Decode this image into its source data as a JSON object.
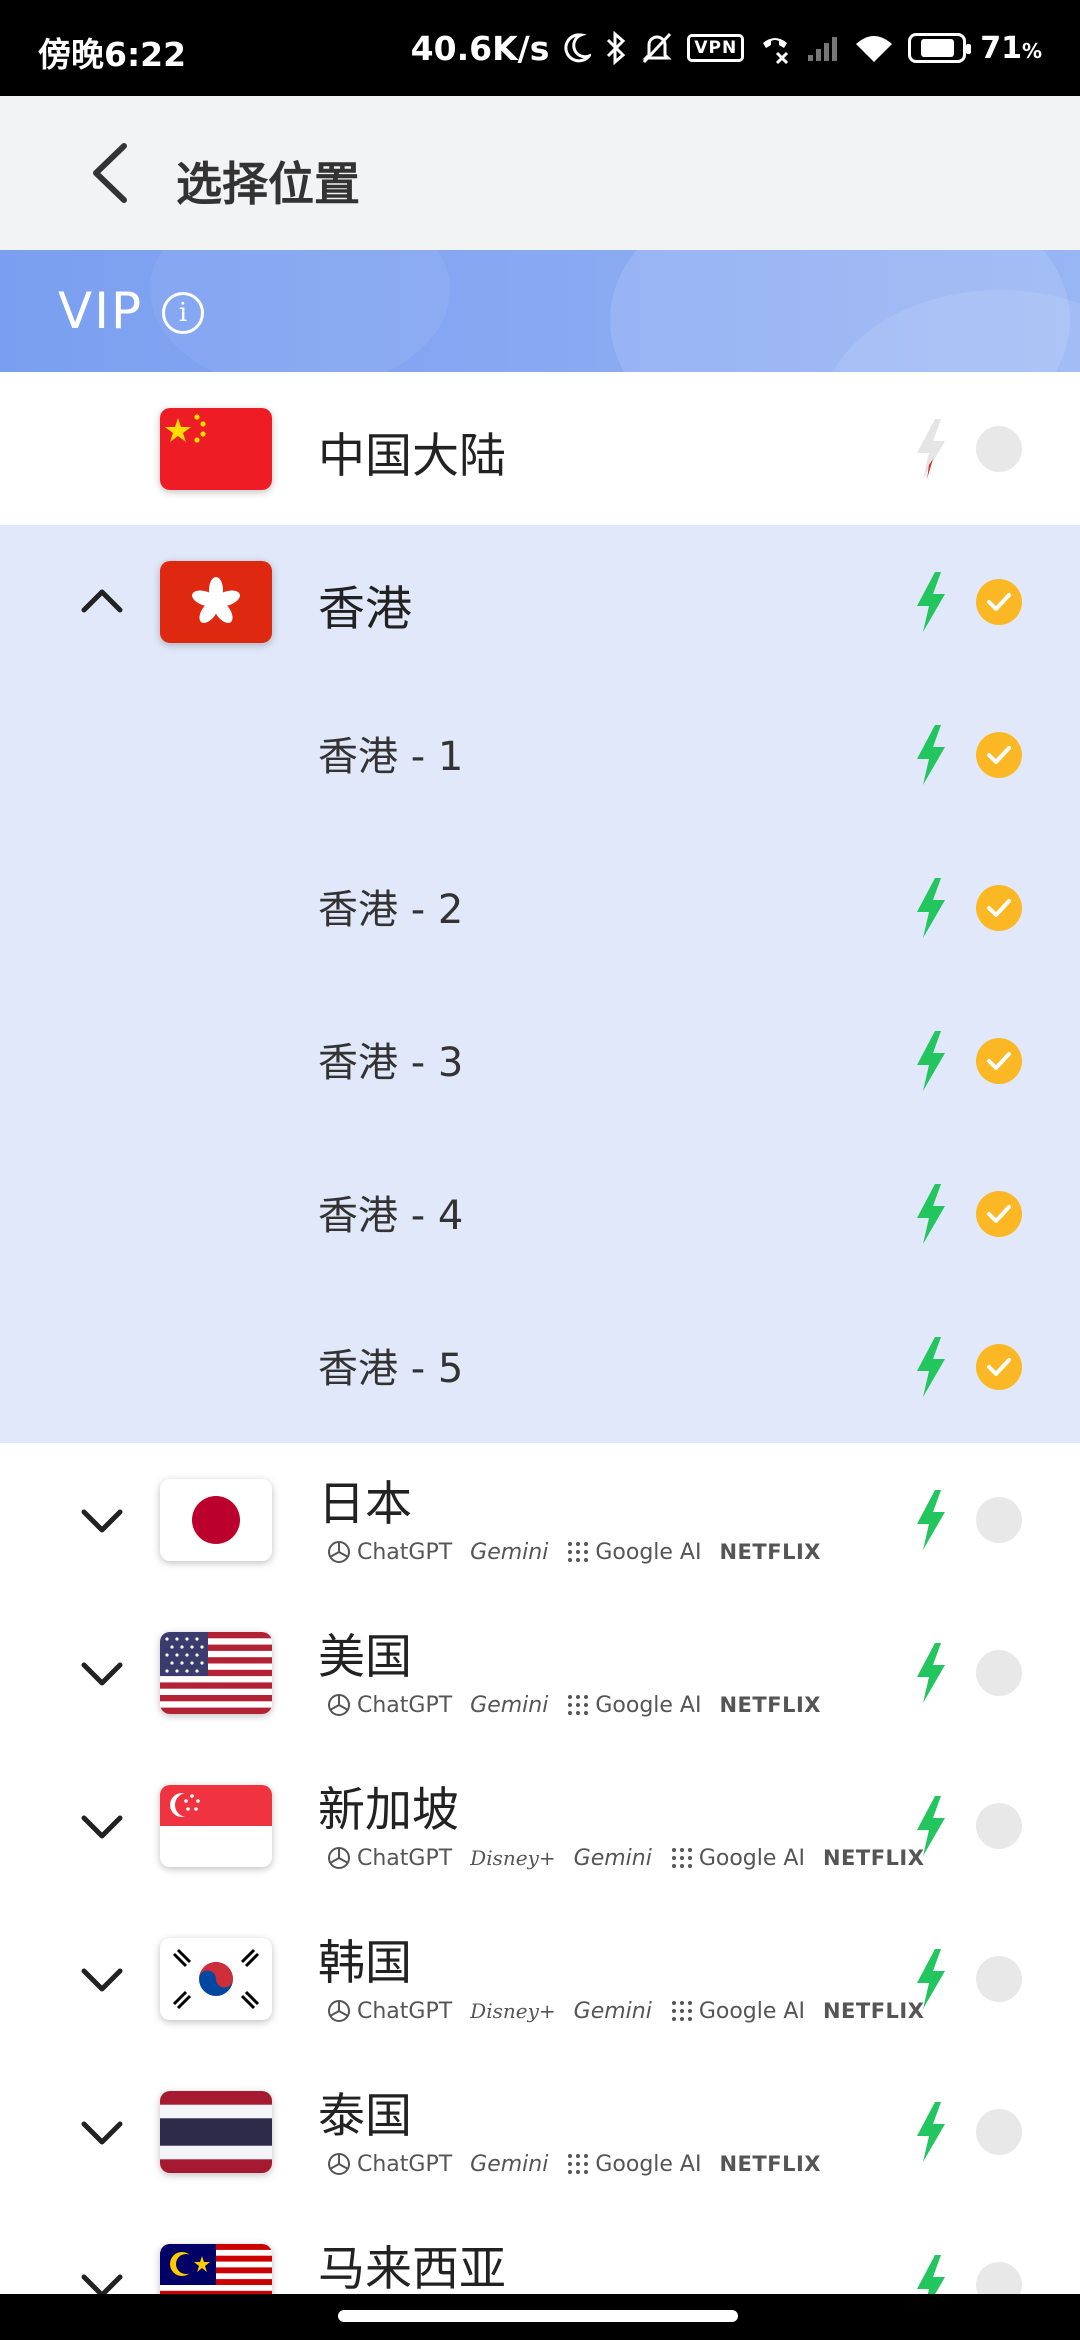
{
  "status_bar": {
    "time": "傍晚6:22",
    "speed": "40.6K/s",
    "vpn": "VPN",
    "battery_level": 0.71,
    "battery_pct": "71",
    "battery_unit": "%"
  },
  "header": {
    "title": "选择位置"
  },
  "vip": {
    "label": "VIP",
    "info_glyph": "i"
  },
  "colors": {
    "accent": "#fbb824",
    "bolt": "#22c55e",
    "selected_bg": "#e0e8f9",
    "vip_bg": "#7b9ff0"
  },
  "services": {
    "chatgpt": "ChatGPT",
    "gemini": "Gemini",
    "google_ai": "Google AI",
    "netflix": "NETFLIX",
    "disney": "Disney+"
  },
  "locations": [
    {
      "name": "中国大陆",
      "flag": "cn-flag",
      "selected": false
    },
    {
      "name": "香港",
      "flag": "hk-flag",
      "selected": true,
      "expanded": true,
      "servers": [
        "香港 - 1",
        "香港 - 2",
        "香港 - 3",
        "香港 - 4",
        "香港 - 5"
      ]
    },
    {
      "name": "日本",
      "flag": "jp-flag",
      "selected": false
    },
    {
      "name": "美国",
      "flag": "us-flag",
      "selected": false
    },
    {
      "name": "新加坡",
      "flag": "sg-flag",
      "selected": false
    },
    {
      "name": "韩国",
      "flag": "kr-flag",
      "selected": false
    },
    {
      "name": "泰国",
      "flag": "th-flag",
      "selected": false
    },
    {
      "name": "马来西亚",
      "flag": "my-flag",
      "selected": false
    }
  ]
}
